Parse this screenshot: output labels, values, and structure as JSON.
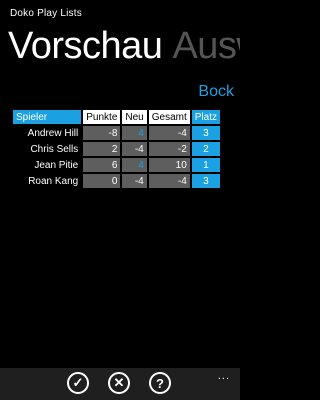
{
  "app": {
    "title": "Doko Play Lists"
  },
  "pivot": {
    "active": "Vorschau",
    "next": "Ausw"
  },
  "link": {
    "bock": "Bock"
  },
  "table": {
    "headers": [
      "Spieler",
      "Punkte",
      "Neu",
      "Gesamt",
      "Platz"
    ],
    "rows": [
      {
        "player": "Andrew Hill",
        "punkte": "-8",
        "neu": "4",
        "gesamt": "-4",
        "platz": "3"
      },
      {
        "player": "Chris Sells",
        "punkte": "2",
        "neu": "-4",
        "gesamt": "-2",
        "platz": "2"
      },
      {
        "player": "Jean Pitie",
        "punkte": "6",
        "neu": "4",
        "gesamt": "10",
        "platz": "1"
      },
      {
        "player": "Roan Kang",
        "punkte": "0",
        "neu": "-4",
        "gesamt": "-4",
        "platz": "3"
      }
    ]
  },
  "appbar": {
    "icons": [
      "check-icon",
      "cancel-icon",
      "help-icon"
    ],
    "glyphs": {
      "check": "✓",
      "cancel": "✕",
      "help": "?"
    },
    "more": "..."
  },
  "colors": {
    "accent": "#1ba1e2",
    "cell": "#5e5e5e",
    "background": "#000000"
  }
}
